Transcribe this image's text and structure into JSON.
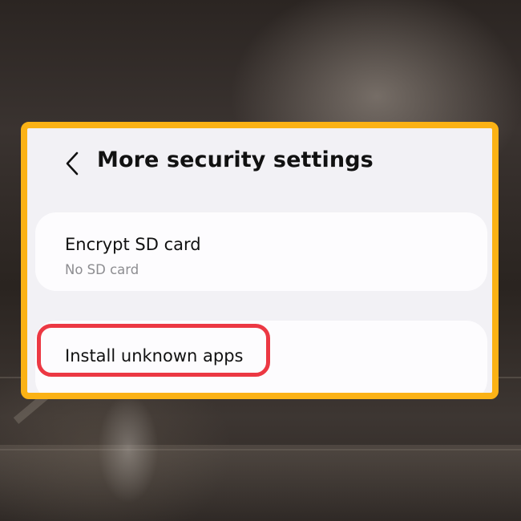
{
  "header": {
    "back_icon": "chevron-left-icon",
    "title": "More security settings"
  },
  "items": [
    {
      "title": "Encrypt SD card",
      "subtitle": "No SD card"
    },
    {
      "title": "Install unknown apps"
    }
  ],
  "colors": {
    "frame_border": "#fbb215",
    "highlight_border": "#ec3843",
    "panel_bg": "#f2f1f5",
    "group_bg": "#fdfcfe",
    "title_text": "#111111",
    "subtitle_text": "#8d8d91"
  }
}
